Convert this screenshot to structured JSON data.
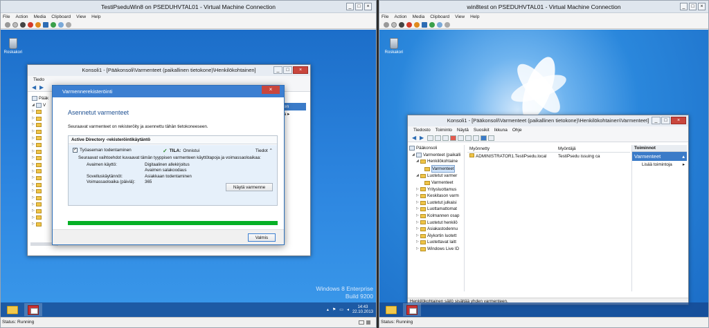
{
  "vm_left": {
    "title": "TestiPseduWin8 on PSEDUHVTAL01 - Virtual Machine Connection",
    "menu": [
      "File",
      "Action",
      "Media",
      "Clipboard",
      "View",
      "Help"
    ],
    "status": "Status: Running",
    "recycle_label": "Roskakori",
    "watermark_line1": "Windows 8 Enterprise",
    "watermark_line2": "Build 9200",
    "clock_time": "14:43",
    "clock_date": "22.10.2013",
    "console": {
      "title": "Konsoli1 - [Pääkonsoli\\Varmenteet (paikallinen tietokone)\\Henkilökohtainen]",
      "menu_first": "Tiedo",
      "tree_first": "Pääk",
      "tree_second": "V",
      "actions_fragment": "inen",
      "actions_item_fragment": "oja"
    },
    "dialog": {
      "title": "Varmennerekisteröinti",
      "heading": "Asennetut varmenteet",
      "intro": "Seuraavat varmenteet on rekisteröity ja asennettu tähän tietokoneeseen.",
      "group_title": "Active Directory -rekisteröintikäytäntö",
      "cert_name": "Työaseman todentaminen",
      "status_label": "TILA:",
      "status_value": "Onnistui",
      "details_link": "Tiedot",
      "options_text": "Seuraavat vaihtoehdot kuvaavat tämän tyyppisen varmenteen käyttötapoja ja voimassaoloaikaa:",
      "key_usage_label": "Avaimen käyttö:",
      "key_usage_value1": "Digitaalinen allekirjoitus",
      "key_usage_value2": "Avaimen salakoodaus",
      "app_policies_label": "Sovelluskäytännöt:",
      "app_policies_value": "Asiakkaan todentaminen",
      "validity_label": "Voimassaoloaika (päiviä):",
      "validity_value": "365",
      "view_cert_button": "Näytä varmenne",
      "finish_button": "Valmis",
      "progress": 1.0
    }
  },
  "vm_right": {
    "title": "win8test on PSEDUHVTAL01 - Virtual Machine Connection",
    "menu": [
      "File",
      "Action",
      "Media",
      "Clipboard",
      "View",
      "Help"
    ],
    "status": "Status: Running",
    "recycle_label": "Roskakori",
    "console": {
      "title": "Konsoli1 - [Pääkonsoli\\Varmenteet (paikallinen tietokone)\\Henkilökohtainen\\Varmenteet]",
      "menu": [
        "Tiedosto",
        "Toiminto",
        "Näytä",
        "Suosikit",
        "Ikkuna",
        "Ohje"
      ],
      "tree": [
        "Pääkonsoli",
        "Varmenteet (paikalli",
        "Henkilökohtaine",
        "Varmenteet",
        "Luotetut varmer",
        "Varmenteet",
        "Yritysluottamus",
        "Keskitason varm",
        "Luotetut julkaisi",
        "Luottamattomat",
        "Kolmannen osap",
        "Luotetut henkilö",
        "Asiakastodennu",
        "Älykortin luotett",
        "Luotettavat laitt",
        "Windows Live ID"
      ],
      "columns": [
        "Myönnetty",
        "Myöntäjä"
      ],
      "row": {
        "issued_to": "ADMINISTRATOR1.TestiPsedu.local",
        "issuer": "TestiPsedu issuing ca"
      },
      "actions_title": "Toiminnot",
      "actions_subtitle": "Varmenteet",
      "actions_item": "Lisää toimintoja",
      "statusbar": "Henkilökohtainen säilö sisältää yhden varmenteen."
    }
  }
}
